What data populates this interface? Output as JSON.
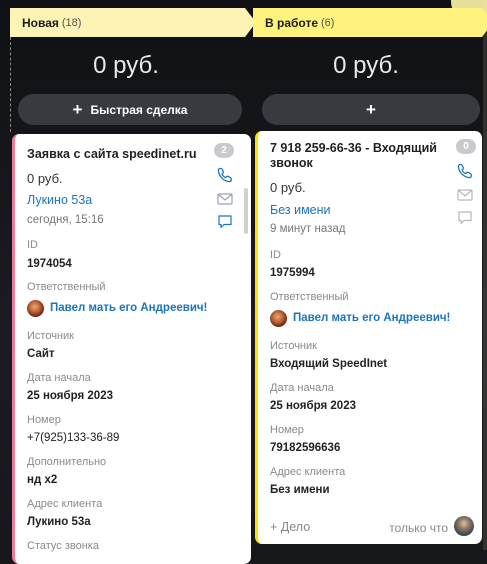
{
  "columns": [
    {
      "title": "Новая",
      "count": "(18)",
      "sum": "0 руб.",
      "quick_button": "Быстрая сделка",
      "card": {
        "title": "Заявка с сайта speedinet.ru",
        "badge": "2",
        "price": "0 руб.",
        "contact": "Лукино 53а",
        "date": "сегодня, 15:16",
        "fields": [
          {
            "label": "ID",
            "value": "1974054"
          },
          {
            "label": "Ответственный",
            "value": "Павел мать его Андреевич!"
          },
          {
            "label": "Источник",
            "value": "Сайт"
          },
          {
            "label": "Дата начала",
            "value": "25 ноября 2023"
          },
          {
            "label": "Номер",
            "value": "+7(925)133-36-89"
          },
          {
            "label": "Дополнительно",
            "value": "нд х2"
          },
          {
            "label": "Адрес клиента",
            "value": "Лукино 53а"
          },
          {
            "label": "Статус звонка",
            "value": ""
          }
        ]
      }
    },
    {
      "title": "В работе",
      "count": "(6)",
      "sum": "0 руб.",
      "quick_button": "",
      "card": {
        "title": "7 918 259-66-36 - Входящий звонок",
        "badge": "0",
        "price": "0 руб.",
        "contact": "Без имени",
        "date": "9 минут назад",
        "fields": [
          {
            "label": "ID",
            "value": "1975994"
          },
          {
            "label": "Ответственный",
            "value": "Павел мать его Андреевич!"
          },
          {
            "label": "Источник",
            "value": "Входящий SpeedInet"
          },
          {
            "label": "Дата начала",
            "value": "25 ноября 2023"
          },
          {
            "label": "Номер",
            "value": "79182596636"
          },
          {
            "label": "Адрес клиента",
            "value": "Без имени"
          }
        ],
        "add_task": "+ Дело",
        "last_activity": "только что"
      }
    }
  ],
  "colors": {
    "board_bg": "#15171b",
    "new_header": "#fcf3b5",
    "work_header": "#fff37e",
    "new_card_accent": "#ef7a9a",
    "work_card_accent": "#ffe200",
    "link": "#1b75bb"
  },
  "icons": [
    "phone-icon",
    "mail-icon",
    "chat-icon",
    "plus-icon"
  ]
}
